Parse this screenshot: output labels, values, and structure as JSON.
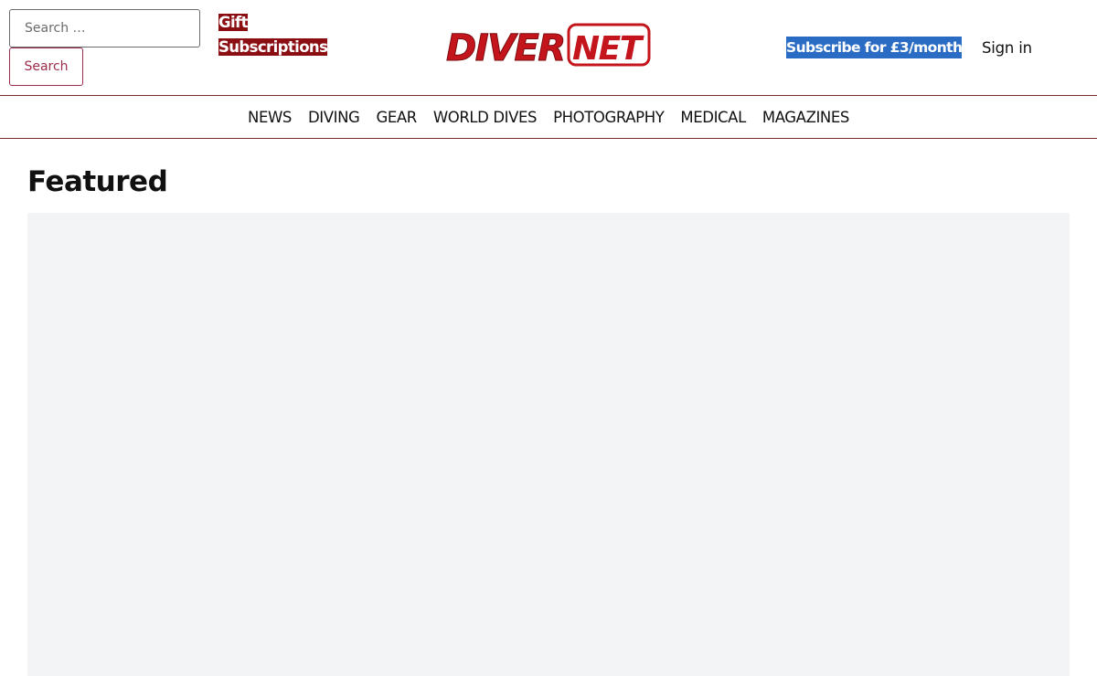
{
  "header": {
    "search": {
      "placeholder": "Search …",
      "value": "",
      "button_label": "Search"
    },
    "gift_link": [
      "Gift",
      "Subscriptions"
    ],
    "logo": {
      "part1": "DIVER",
      "part2": "NET"
    },
    "subscribe_label": "Subscribe for £3/month",
    "signin_label": "Sign in"
  },
  "nav": {
    "items": [
      "NEWS",
      "DIVING",
      "GEAR",
      "WORLD DIVES",
      "PHOTOGRAPHY",
      "MEDICAL",
      "MAGAZINES"
    ]
  },
  "main": {
    "featured_title": "Featured"
  },
  "colors": {
    "brand_red": "#8a0e12",
    "logo_red": "#c4151c",
    "subscribe_blue": "#2a6cc4",
    "search_button_border": "#9b2c4a",
    "panel_bg": "#f3f4f6"
  }
}
